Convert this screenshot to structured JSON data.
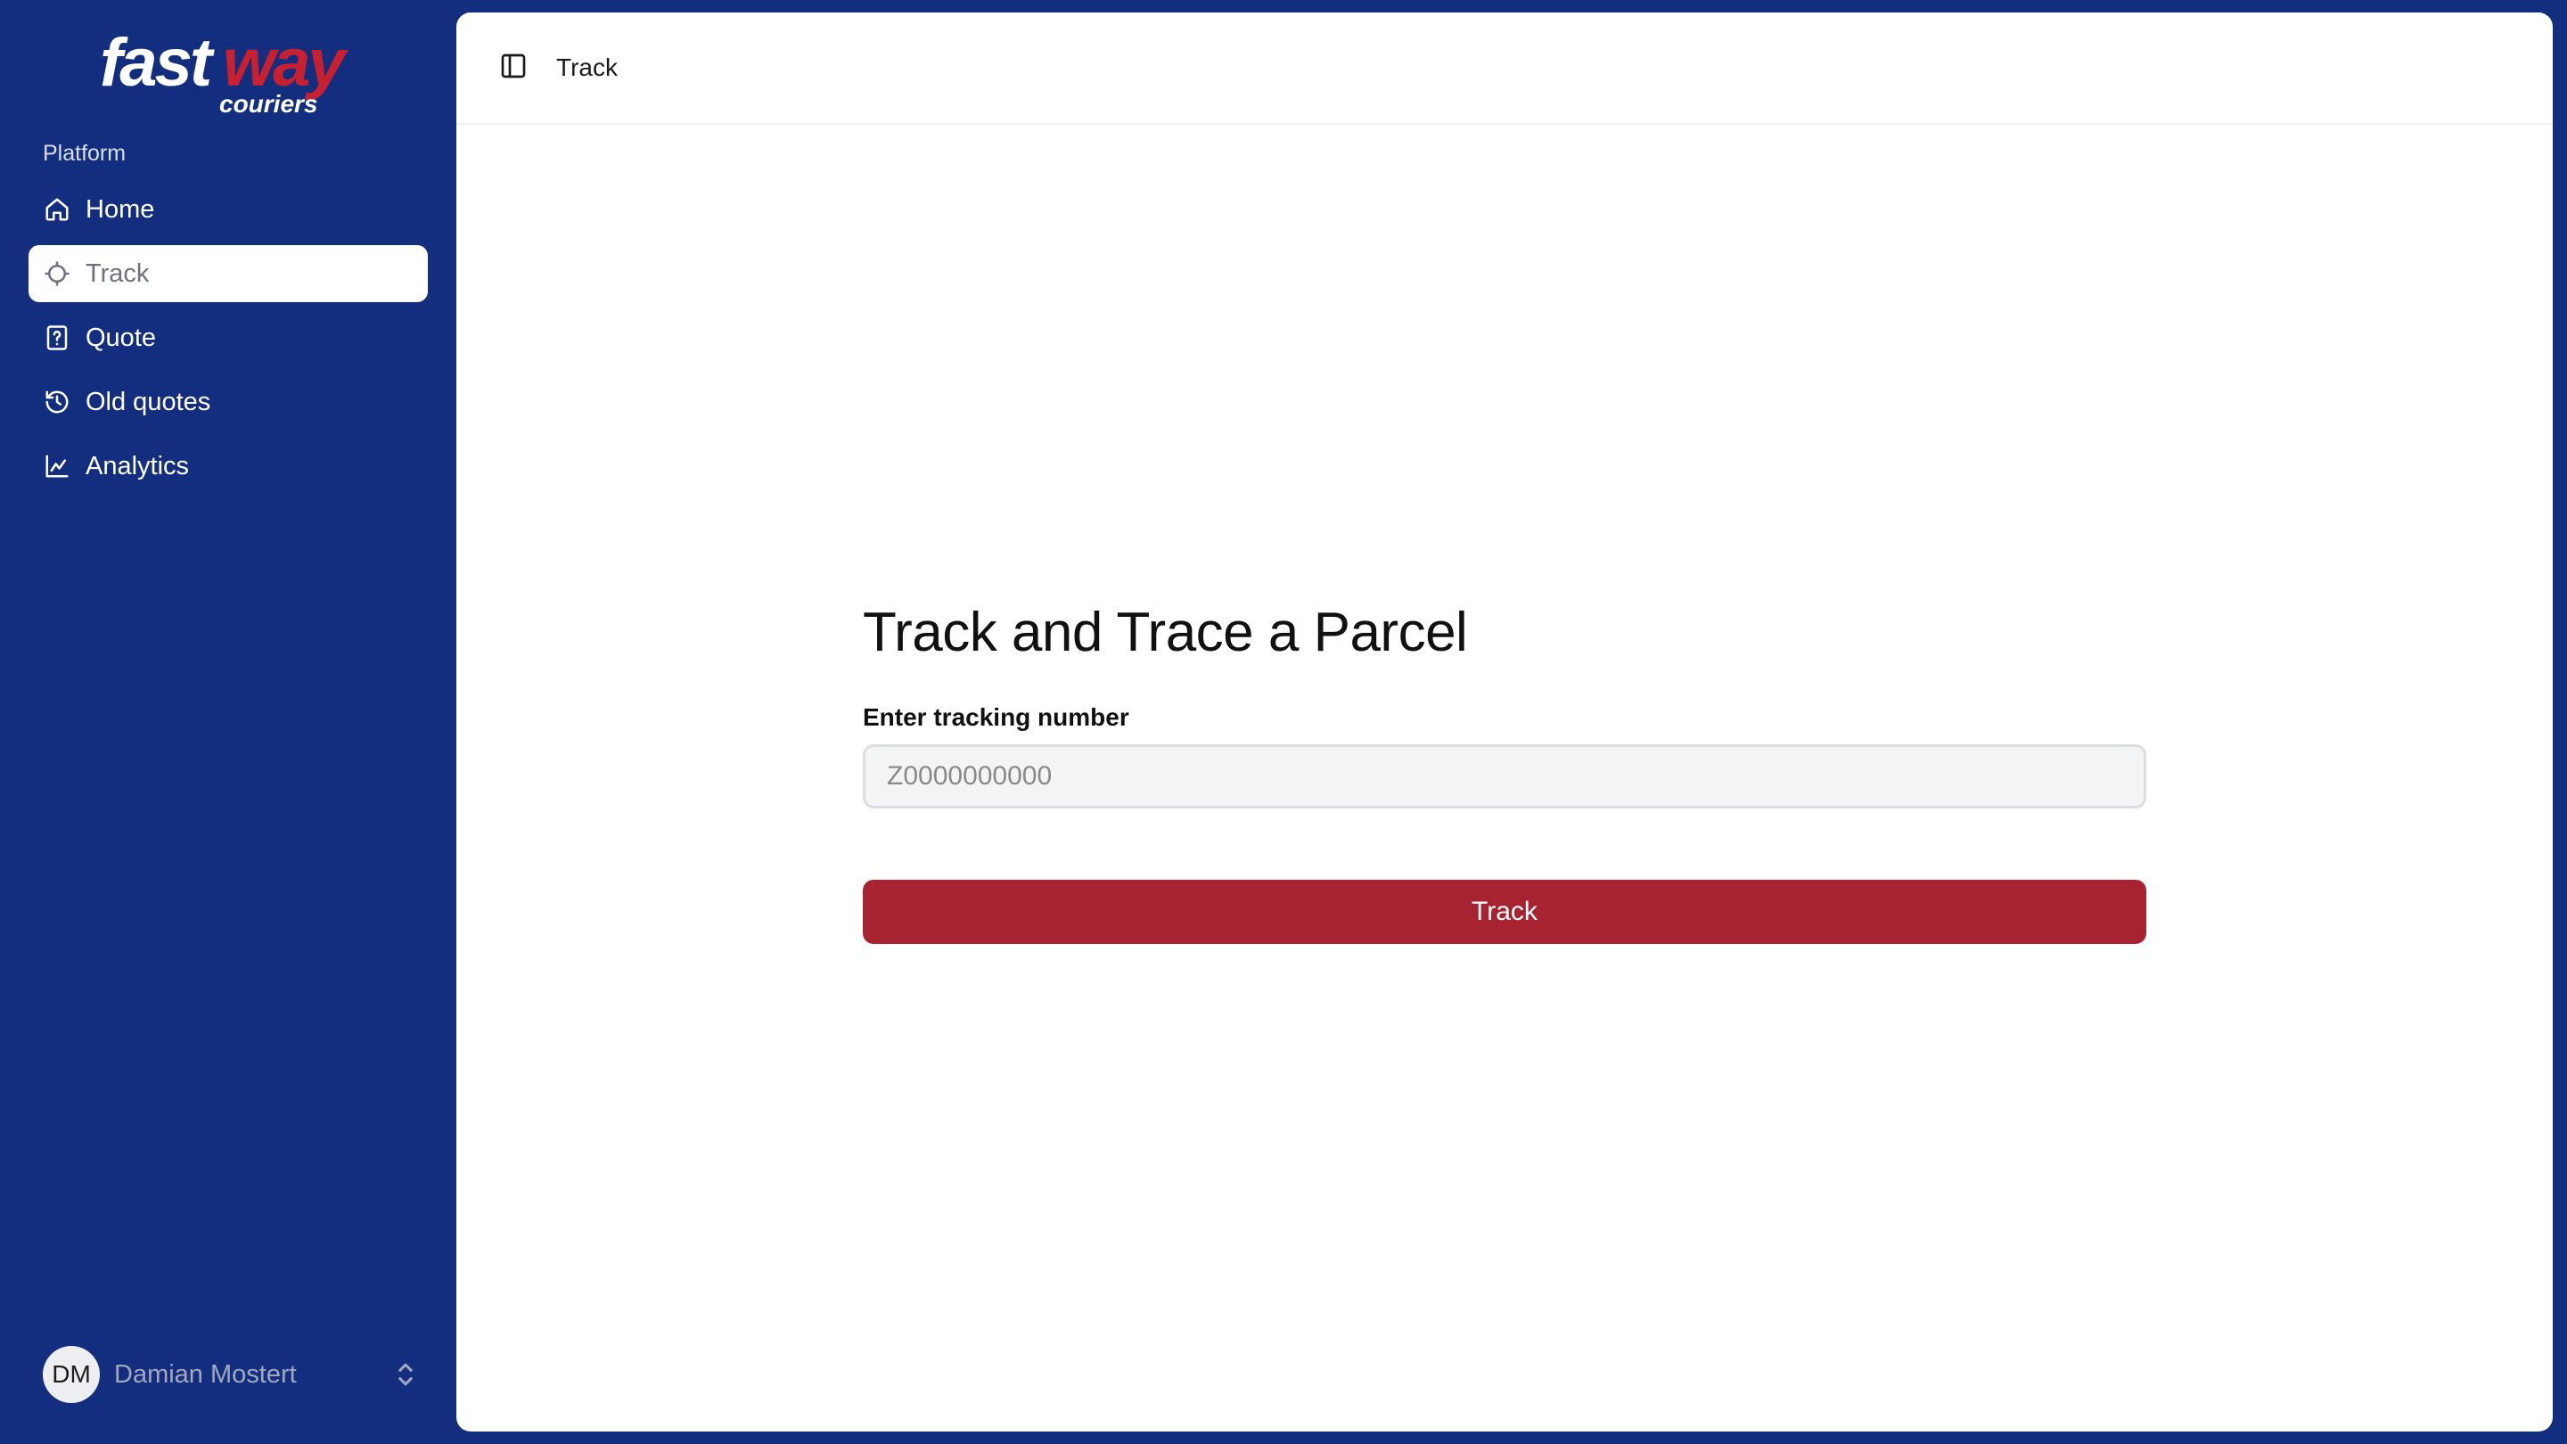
{
  "brand": {
    "logo_text_primary": "fastway",
    "logo_text_secondary": "couriers",
    "logo_colors": {
      "fast": "#ffffff",
      "way": "#c8202f"
    }
  },
  "sidebar": {
    "section_label": "Platform",
    "items": [
      {
        "label": "Home",
        "icon": "home-icon",
        "active": false
      },
      {
        "label": "Track",
        "icon": "crosshair-icon",
        "active": true
      },
      {
        "label": "Quote",
        "icon": "file-question-icon",
        "active": false
      },
      {
        "label": "Old quotes",
        "icon": "history-icon",
        "active": false
      },
      {
        "label": "Analytics",
        "icon": "chart-icon",
        "active": false
      }
    ],
    "user": {
      "initials": "DM",
      "name": "Damian Mostert"
    }
  },
  "header": {
    "breadcrumb": "Track"
  },
  "main": {
    "title": "Track and Trace a Parcel",
    "tracking_label": "Enter tracking number",
    "tracking_placeholder": "Z0000000000",
    "tracking_value": "",
    "track_button": "Track"
  },
  "colors": {
    "sidebar_bg": "#132e7f",
    "accent": "#a82332",
    "panel_bg": "#ffffff"
  }
}
